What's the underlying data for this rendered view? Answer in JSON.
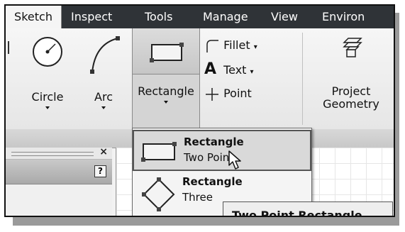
{
  "tabs": [
    "Sketch",
    "Inspect",
    "Tools",
    "Manage",
    "View",
    "Environ"
  ],
  "ribbon": {
    "circle": "Circle",
    "arc": "Arc",
    "rectangle": "Rectangle",
    "fillet": "Fillet",
    "text": "Text",
    "point": "Point",
    "project": "Project",
    "geometry": "Geometry"
  },
  "dropdown": {
    "items": [
      {
        "title": "Rectangle",
        "subtitle": "Two Point",
        "icon": "rectangle-two-point-icon"
      },
      {
        "title": "Rectangle",
        "subtitle": "Three",
        "icon": "rectangle-three-point-icon"
      }
    ]
  },
  "tooltip": "Two Point Rectangle",
  "browser": {
    "close": "×",
    "help": "?"
  }
}
